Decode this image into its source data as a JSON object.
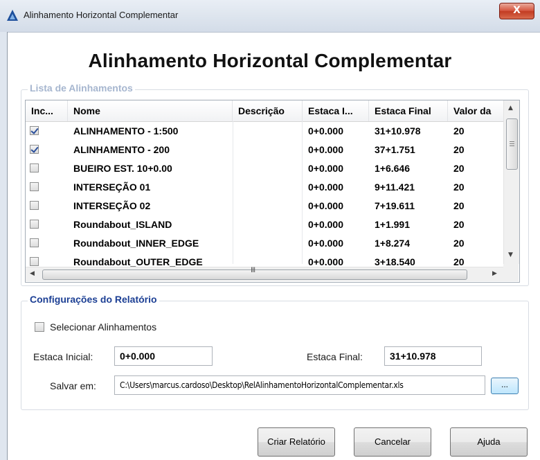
{
  "window": {
    "title": "Alinhamento Horizontal Complementar",
    "close_label": "X"
  },
  "heading": "Alinhamento Horizontal Complementar",
  "list_group": {
    "legend": "Lista de Alinhamentos",
    "columns": [
      "Inc...",
      "Nome",
      "Descrição",
      "Estaca I...",
      "Estaca Final",
      "Valor da"
    ],
    "rows": [
      {
        "checked": true,
        "nome": "ALINHAMENTO - 1:500",
        "descricao": "",
        "estaca_inicial": "0+0.000",
        "estaca_final": "31+10.978",
        "valor": "20"
      },
      {
        "checked": true,
        "nome": "ALINHAMENTO - 200",
        "descricao": "",
        "estaca_inicial": "0+0.000",
        "estaca_final": "37+1.751",
        "valor": "20"
      },
      {
        "checked": false,
        "nome": "BUEIRO EST. 10+0.00",
        "descricao": "",
        "estaca_inicial": "0+0.000",
        "estaca_final": "1+6.646",
        "valor": "20"
      },
      {
        "checked": false,
        "nome": "INTERSEÇÃO 01",
        "descricao": "",
        "estaca_inicial": "0+0.000",
        "estaca_final": "9+11.421",
        "valor": "20"
      },
      {
        "checked": false,
        "nome": "INTERSEÇÃO 02",
        "descricao": "",
        "estaca_inicial": "0+0.000",
        "estaca_final": "7+19.611",
        "valor": "20"
      },
      {
        "checked": false,
        "nome": "Roundabout_ISLAND",
        "descricao": "",
        "estaca_inicial": "0+0.000",
        "estaca_final": "1+1.991",
        "valor": "20"
      },
      {
        "checked": false,
        "nome": "Roundabout_INNER_EDGE",
        "descricao": "",
        "estaca_inicial": "0+0.000",
        "estaca_final": "1+8.274",
        "valor": "20"
      },
      {
        "checked": false,
        "nome": "Roundabout_OUTER_EDGE",
        "descricao": "",
        "estaca_inicial": "0+0.000",
        "estaca_final": "3+18.540",
        "valor": "20"
      }
    ],
    "hscroll_grip": "III"
  },
  "config_group": {
    "legend": "Configurações do Relatório",
    "select_label": "Selecionar Alinhamentos",
    "select_checked": false,
    "estaca_inicial_label": "Estaca Inicial:",
    "estaca_inicial_value": "0+0.000",
    "estaca_final_label": "Estaca Final:",
    "estaca_final_value": "31+10.978",
    "salvar_label": "Salvar em:",
    "salvar_value": "C:\\Users\\marcus.cardoso\\Desktop\\RelAlinhamentoHorizontalComplementar.xls",
    "browse_label": "..."
  },
  "buttons": {
    "criar": "Criar Relatório",
    "cancelar": "Cancelar",
    "ajuda": "Ajuda"
  }
}
